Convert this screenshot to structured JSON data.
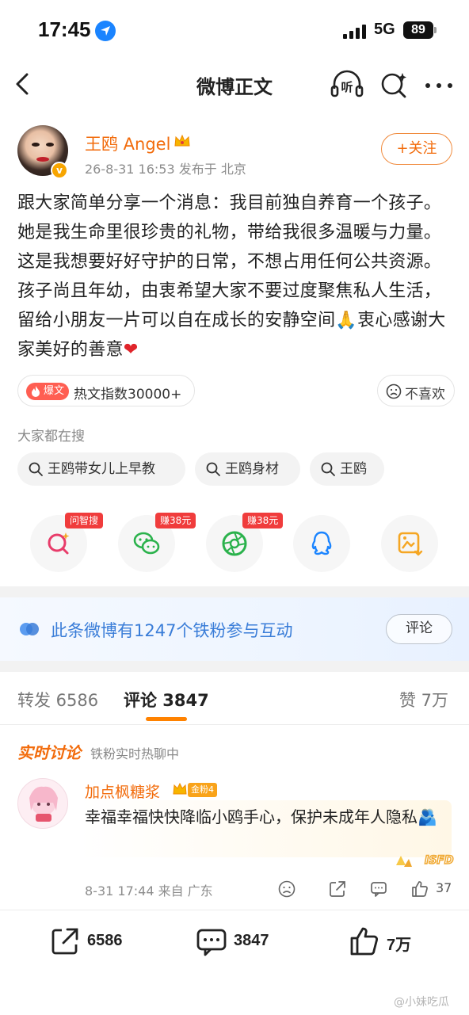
{
  "status_bar": {
    "time": "17:45",
    "network": "5G",
    "battery": "89"
  },
  "nav": {
    "title": "微博正文",
    "listen_label": "听"
  },
  "post": {
    "author": "王鸥 Angel",
    "verified_mark": "v",
    "meta": "26-8-31 16:53  发布于 北京",
    "follow_label": "+关注",
    "body": "跟大家简单分享一个消息：我目前独自养育一个孩子。她是我生命里很珍贵的礼物，带给我很多温暖与力量。这是我想要好好守护的日常，不想占用任何公共资源。孩子尚且年幼，由衷希望大家不要过度聚焦私人生活，留给小朋友一片可以自在成长的安静空间🙏衷心感谢大家美好的善意",
    "heart": "❤",
    "hot_tag": "爆文",
    "hot_text": "热文指数30000+",
    "dislike_label": "不喜欢"
  },
  "searches": {
    "heading": "大家都在搜",
    "chips": [
      "王鸥带女儿上早教",
      "王鸥身材",
      "王鸥"
    ]
  },
  "share_tags": {
    "ask": "问智搜",
    "wechat": "赚38元",
    "moments": "赚38元"
  },
  "fans_banner": {
    "text": "此条微博有1247个铁粉参与互动",
    "button": "评论"
  },
  "tabs": {
    "repost": "转发 6586",
    "comment": "评论 3847",
    "like": "赞 7万"
  },
  "realtime": {
    "title": "实时讨论",
    "subtitle": "铁粉实时热聊中"
  },
  "comment": {
    "user": "加点枫糖浆",
    "badge": "金粉4",
    "text": "幸福幸福快快降临小鸥手心，保护未成年人隐私🫂",
    "meta": "8-31 17:44  来自 广东",
    "likes": "37"
  },
  "toolbar": {
    "repost": "6586",
    "comment": "3847",
    "like": "7万"
  },
  "watermark": "@小妹吃瓜",
  "colors": {
    "accent": "#f26b0b",
    "link_blue": "#3a7dd8",
    "tab_underline": "#ff8200"
  }
}
